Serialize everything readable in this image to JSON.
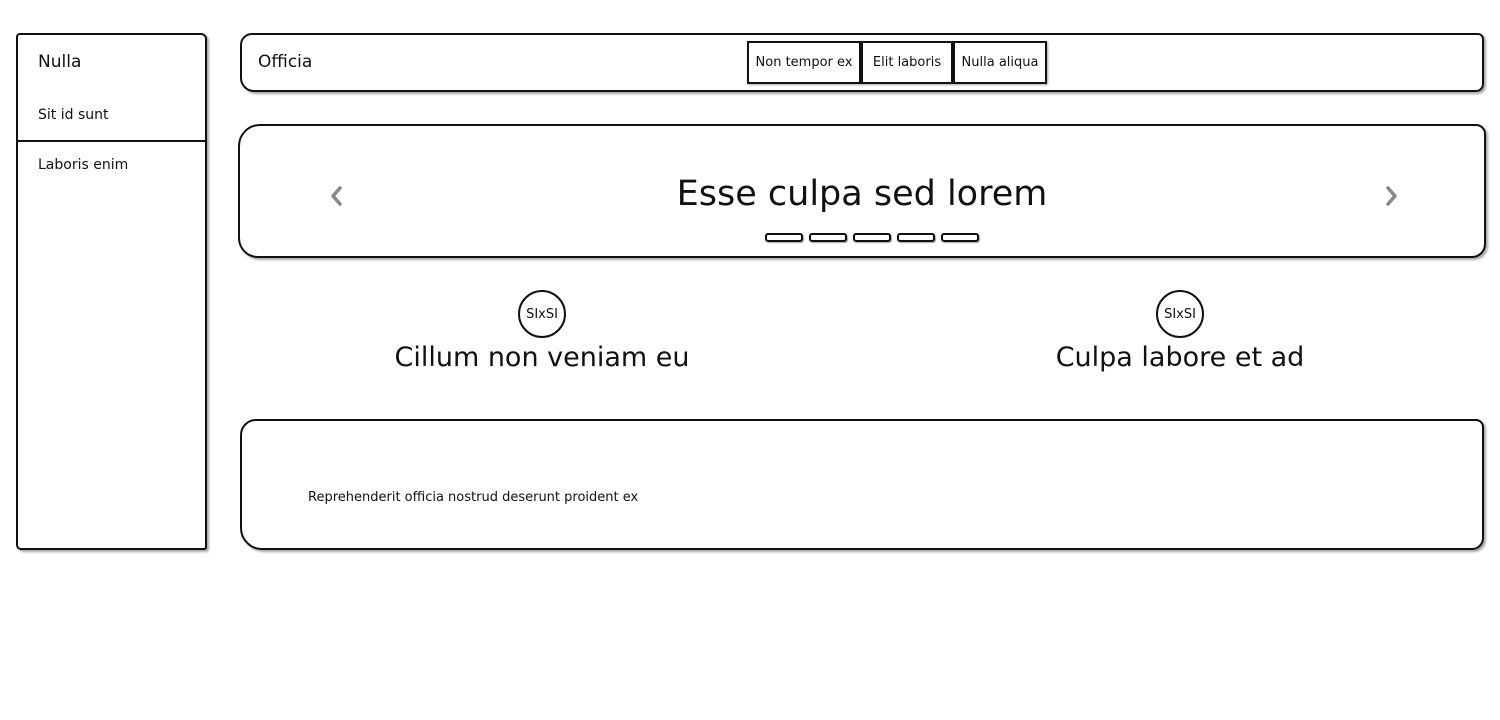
{
  "sidebar": {
    "title": "Nulla",
    "items": [
      "Sit id sunt",
      "Laboris enim"
    ]
  },
  "navbar": {
    "brand": "Officia",
    "buttons": [
      "Non tempor ex",
      "Elit laboris",
      "Nulla aliqua"
    ]
  },
  "carousel": {
    "title": "Esse culpa sed lorem",
    "prev_icon": "chevron-left-icon",
    "next_icon": "chevron-right-icon",
    "arrow_color": "#888888",
    "dot_count": 5
  },
  "features": [
    {
      "avatar": "SIxSI",
      "title": "Cillum non veniam eu"
    },
    {
      "avatar": "SIxSI",
      "title": "Culpa labore et ad"
    }
  ],
  "panel": {
    "text": "Reprehenderit officia nostrud deserunt proident ex"
  }
}
